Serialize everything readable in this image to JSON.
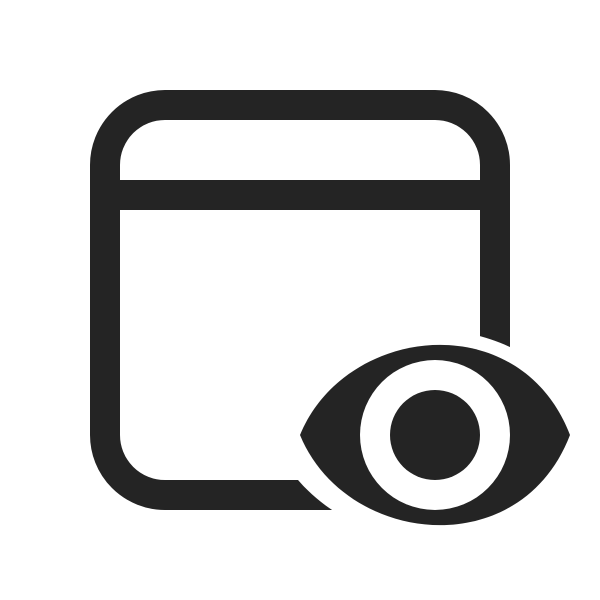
{
  "icon": {
    "name": "window-eye-icon",
    "color": "#242424",
    "background": "#ffffff"
  }
}
